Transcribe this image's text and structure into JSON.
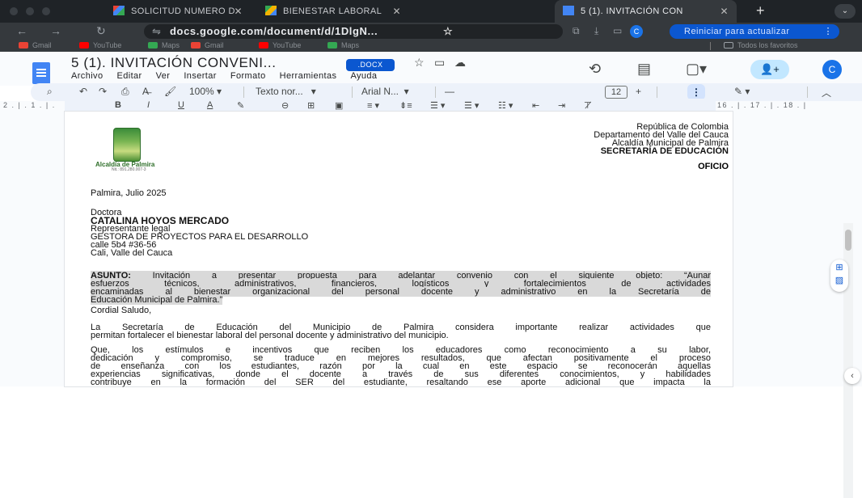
{
  "browser": {
    "tabs": [
      {
        "label": "SOLICITUD NUMERO D",
        "close": "✕",
        "color": "#ea4335"
      },
      {
        "label": "BIENESTAR LABORAL",
        "close": "✕",
        "color": "#f4b400"
      },
      {
        "label": "5 (1). INVITACIÓN CON",
        "close": "✕",
        "color": "#4285f4"
      }
    ],
    "new_tab": "+",
    "tab_menu": "⌄",
    "url": "docs.google.com/document/d/1DlgN...",
    "update_button": "Reiniciar para actualizar",
    "update_kebab": "⋮",
    "profile_initial": "C",
    "bookmarks": [
      "Gmail",
      "YouTube",
      "Maps",
      "Gmail",
      "YouTube",
      "Maps"
    ],
    "all_bookmarks": "Todos los favoritos"
  },
  "docs": {
    "title": "5 (1). INVITACIÓN CONVENI...",
    "badge": ".DOCX",
    "menu": [
      "Archivo",
      "Editar",
      "Ver",
      "Insertar",
      "Formato",
      "Herramientas",
      "Ayuda"
    ],
    "avatar": "C",
    "toolbar": {
      "zoom": "100%",
      "style": "Texto nor...",
      "font": "Arial N...",
      "minus": "—",
      "size": "12",
      "plus": "+"
    },
    "ruler_left": "2 . | . 1 . | .",
    "ruler_right": "16 . | . 17 . | . 18 . |",
    "format_row": [
      "B",
      "I",
      "U",
      "A"
    ]
  },
  "letter": {
    "logo_caption": "Alcaldía de Palmira",
    "logo_nit": "Nit.: 891.280.007-3",
    "header": [
      "República de Colombia",
      "Departamento del Valle del Cauca",
      "Alcaldía Municipal de Palmira",
      "SECRETARÍA DE EDUCACIÓN"
    ],
    "oficio": "OFICIO",
    "date": "Palmira, Julio 2025",
    "salutation_title": "Doctora",
    "recipient": "CATALINA HOYOS MERCADO",
    "address": [
      "Representante legal",
      "GESTORA DE PROYECTOS PARA EL DESARROLLO",
      "calle 5b4 #36-56",
      "Cali, Valle del Cauca"
    ],
    "asunto_label": "ASUNTO:",
    "asunto": [
      " Invitación a presentar propuesta para adelantar convenio con el siguiente objeto: “Aunar",
      "esfuerzos técnicos, administrativos, financieros, logísticos y fortalecimientos de actividades",
      "encaminadas al bienestar organizacional del personal docente y administrativo en la Secretaría de",
      "Educación Municipal de Palmira.”"
    ],
    "greeting": "Cordial Saludo,",
    "p1": [
      "La Secretaría de Educación del Municipio de Palmira considera importante realizar actividades que",
      "permitan fortalecer el bienestar laboral del personal docente y administrativo del municipio."
    ],
    "p2": [
      "Que, los estímulos e incentivos que reciben los educadores como reconocimiento a su labor,",
      "dedicación y compromiso, se traduce en mejores resultados, que afectan positivamente el proceso",
      "de enseñanza con los estudiantes, razón por la cual en este espacio se reconocerán aquellas",
      "experiencias significativas, donde el docente a través de sus diferentes conocimientos, y habilidades",
      "contribuye en la formación del SER del estudiante, resaltando ese aporte adicional que impacta la"
    ]
  }
}
